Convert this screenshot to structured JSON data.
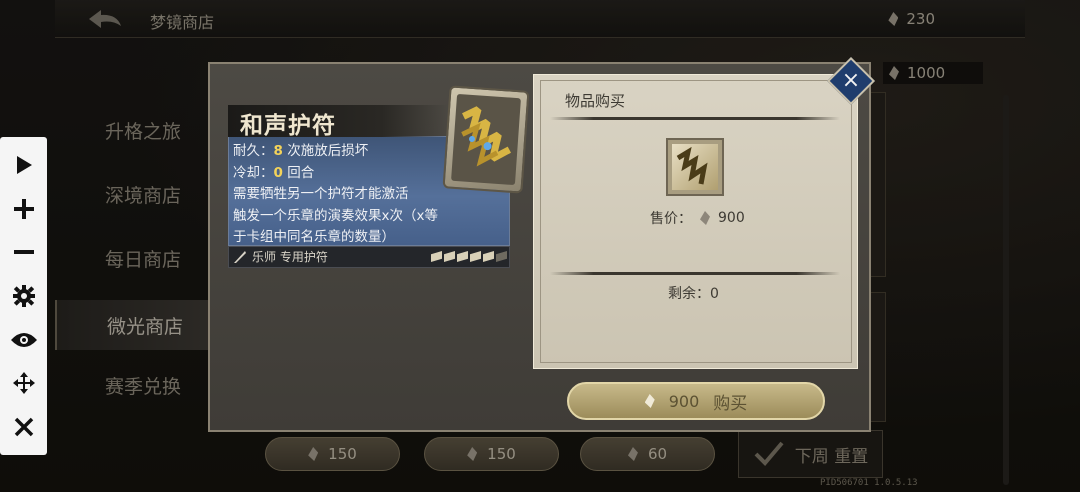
{
  "shop": {
    "back_label": "",
    "title": "梦镜商店",
    "currency_primary": "230",
    "currency_secondary": "1000",
    "sidebar": [
      {
        "label": "升格之旅",
        "active": false
      },
      {
        "label": "深境商店",
        "active": false
      },
      {
        "label": "每日商店",
        "active": false
      },
      {
        "label": "微光商店",
        "active": true
      },
      {
        "label": "赛季兑换",
        "active": false
      }
    ],
    "price_buttons": [
      "150",
      "150",
      "60"
    ],
    "reset_label": "下周 重置",
    "version": "PID506701  1.0.5.13"
  },
  "item_card": {
    "name": "和声护符",
    "durability_label": "耐久：",
    "durability_value": "8",
    "durability_suffix": " 次施放后损坏",
    "cooldown_label": "冷却：",
    "cooldown_value": "0",
    "cooldown_suffix": " 回合",
    "line3": "需要牺牲另一个护符才能激活",
    "line4": "触发一个乐章的演奏效果x次（x等",
    "line5": "于卡组中同名乐章的数量）",
    "class_label": "乐师 专用护符",
    "pips_filled": 5,
    "pips_total": 6
  },
  "purchase": {
    "title": "物品购买",
    "price_label": "售价：",
    "price_value": "900",
    "remaining_label": "剩余：",
    "remaining_value": "0",
    "buy_price": "900",
    "buy_label": "购买"
  },
  "toolbar": {
    "icons": [
      "play-icon",
      "plus-icon",
      "minus-icon",
      "gear-icon",
      "eye-icon",
      "move-icon",
      "close-icon"
    ]
  },
  "colors": {
    "accent_gold": "#f3d35a",
    "card_blue": "#55709a",
    "close_blue": "#1f3d6d",
    "buy_gold": "#c7b98a"
  }
}
